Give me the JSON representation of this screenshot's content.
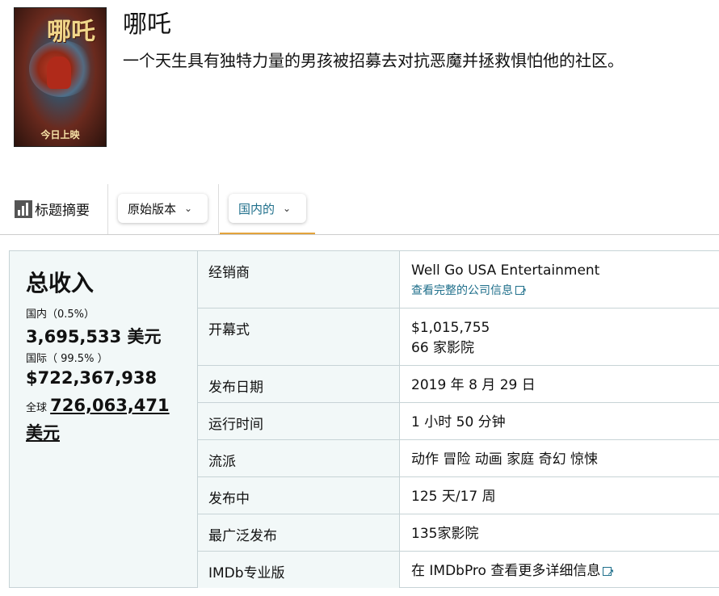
{
  "movie": {
    "title": "哪吒",
    "description": "一个天生具有独特力量的男孩被招募去对抗恶魔并拯救惧怕他的社区。",
    "poster": {
      "title_art": "哪吒",
      "bottom_text": "今日上映"
    }
  },
  "tabs": {
    "summary_label": "标题摘要",
    "version_dropdown": "原始版本",
    "region_dropdown": "国内的"
  },
  "gross": {
    "heading": "总收入",
    "domestic_label": "国内（0.5%）",
    "domestic_value": "3,695,533 美元",
    "international_label": "国际（ 99.5% ）",
    "international_value": "$722,367,938",
    "worldwide_label": "全球",
    "worldwide_value": "726,063,471 美元"
  },
  "details": {
    "distributor_label": "经销商",
    "distributor_value": "Well Go USA Entertainment",
    "distributor_link": "查看完整的公司信息",
    "opening_label": "开幕式",
    "opening_value": "$1,015,755",
    "opening_theaters": "66 家影院",
    "release_label": "发布日期",
    "release_value": "2019 年 8 月 29 日",
    "runtime_label": "运行时间",
    "runtime_value": "1 小时 50 分钟",
    "genres_label": "流派",
    "genres_value": "动作 冒险 动画 家庭 奇幻 惊悚",
    "in_release_label": "发布中",
    "in_release_value": "125 天/17 周",
    "widest_label": "最广泛发布",
    "widest_value": "135家影院",
    "imdb_label": "IMDb专业版",
    "imdb_value": "在 IMDbPro 查看更多详细信息"
  },
  "colors": {
    "link": "#1f6f8b",
    "accent_underline": "#e3a33b",
    "panel_bg": "#f2f8f8"
  },
  "icons": {
    "summary": "bar-chart-icon",
    "dropdown": "chevron-down-icon",
    "external": "external-link-icon"
  }
}
